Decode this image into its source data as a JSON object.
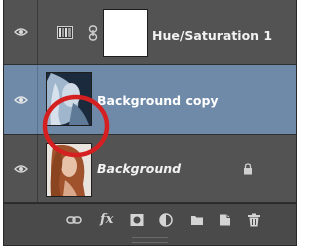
{
  "layers": [
    {
      "name": "Hue/Saturation 1",
      "type": "adjustment",
      "visible": true,
      "selected": false,
      "icons": [
        "eye-icon",
        "adjustment-layer-icon",
        "link-icon",
        "mask-thumbnail"
      ]
    },
    {
      "name": "Background copy",
      "type": "smart-object",
      "visible": true,
      "selected": true,
      "icons": [
        "eye-icon",
        "photo-thumbnail",
        "smart-object-badge-icon"
      ]
    },
    {
      "name": "Background",
      "type": "background",
      "visible": true,
      "selected": false,
      "locked": true,
      "icons": [
        "eye-icon",
        "photo-thumbnail",
        "lock-icon"
      ]
    }
  ],
  "toolbar": {
    "fx_label": "fx",
    "buttons": [
      "link-layers-icon",
      "fx-icon",
      "add-mask-icon",
      "adjustment-icon",
      "folder-icon",
      "new-layer-icon",
      "trash-icon"
    ]
  },
  "colors": {
    "panel_bg": "#535353",
    "selected_row": "#6f8aa8",
    "highlight_circle": "#d42020"
  }
}
